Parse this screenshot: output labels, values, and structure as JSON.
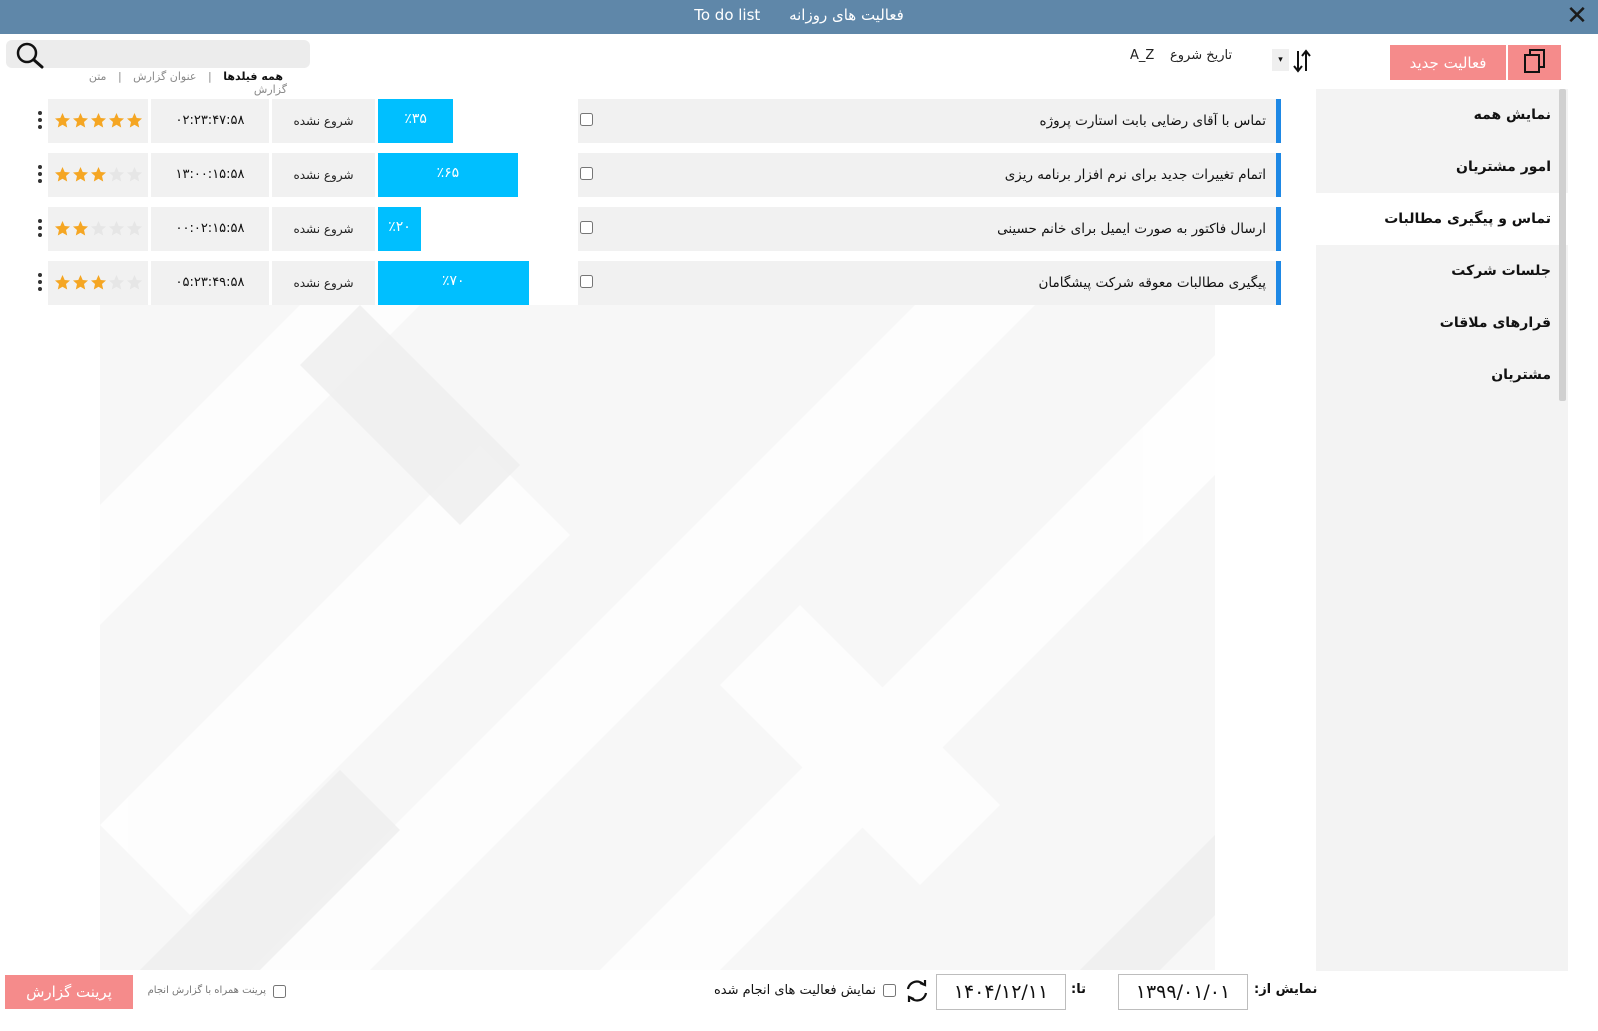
{
  "window": {
    "title_fa": "فعالیت های روزانه",
    "title_en": "To do list",
    "close_icon": "close-icon"
  },
  "search": {
    "placeholder": "",
    "filters": [
      {
        "label": "همه فیلدها",
        "active": true
      },
      {
        "label": "عنوان گزارش",
        "active": false
      },
      {
        "label": "متن گزارش",
        "active": false
      }
    ],
    "separator": "|"
  },
  "toolbar": {
    "sort_az": "A_Z",
    "sort_date": "تاریخ شروع",
    "sort_dropdown_glyph": "▾",
    "new_activity": "فعالیت جدید",
    "copy_icon": "copy-icon",
    "sort_icon": "sort-arrows-icon"
  },
  "sidebar": {
    "items": [
      {
        "label": "نمایش همه",
        "selected": false
      },
      {
        "label": "امور مشتریان",
        "selected": false
      },
      {
        "label": "تماس و پیگیری مطالبات",
        "selected": true
      },
      {
        "label": "جلسات شرکت",
        "selected": false
      },
      {
        "label": "قرارهای ملاقات",
        "selected": false
      },
      {
        "label": "مشتریان",
        "selected": false
      }
    ]
  },
  "tasks": [
    {
      "title": "تماس با آقای رضایی بابت استارت پروژه",
      "progress": 35,
      "progress_label": "٪۳۵",
      "status": "شروع نشده",
      "time": "۰۲:۲۳:۴۷:۵۸",
      "rating": 5,
      "checked": false
    },
    {
      "title": "اتمام تغییرات جدید برای نرم افزار برنامه ریزی",
      "progress": 65,
      "progress_label": "٪۶۵",
      "status": "شروع نشده",
      "time": "۱۳:۰۰:۱۵:۵۸",
      "rating": 3,
      "checked": false
    },
    {
      "title": "ارسال فاکتور به صورت ایمیل برای خانم حسینی",
      "progress": 20,
      "progress_label": "٪۲۰",
      "status": "شروع نشده",
      "time": "۰۰:۰۲:۱۵:۵۸",
      "rating": 2,
      "checked": false
    },
    {
      "title": "پیگیری مطالبات معوقه شرکت پیشگامان",
      "progress": 70,
      "progress_label": "٪۷۰",
      "status": "شروع نشده",
      "time": "۰۵:۲۳:۴۹:۵۸",
      "rating": 3,
      "checked": false
    }
  ],
  "rating_max": 5,
  "footer": {
    "from_label": "نمایش از:",
    "from_date": "۱۳۹۹/۰۱/۰۱",
    "to_label": "تا:",
    "to_date": "۱۴۰۴/۱۲/۱۱",
    "show_done_label": "نمایش فعالیت های انجام شده",
    "print_with_report_label": "پرینت همراه با گزارش انجام",
    "print_button": "پرینت گزارش",
    "refresh_icon": "refresh-icon"
  },
  "colors": {
    "titlebar": "#5f87a9",
    "accent_button": "#f58b8b",
    "progress": "#00bfff",
    "row_accent": "#1e88e5",
    "star_on": "#f5a623",
    "star_off": "#e6e6e6"
  }
}
